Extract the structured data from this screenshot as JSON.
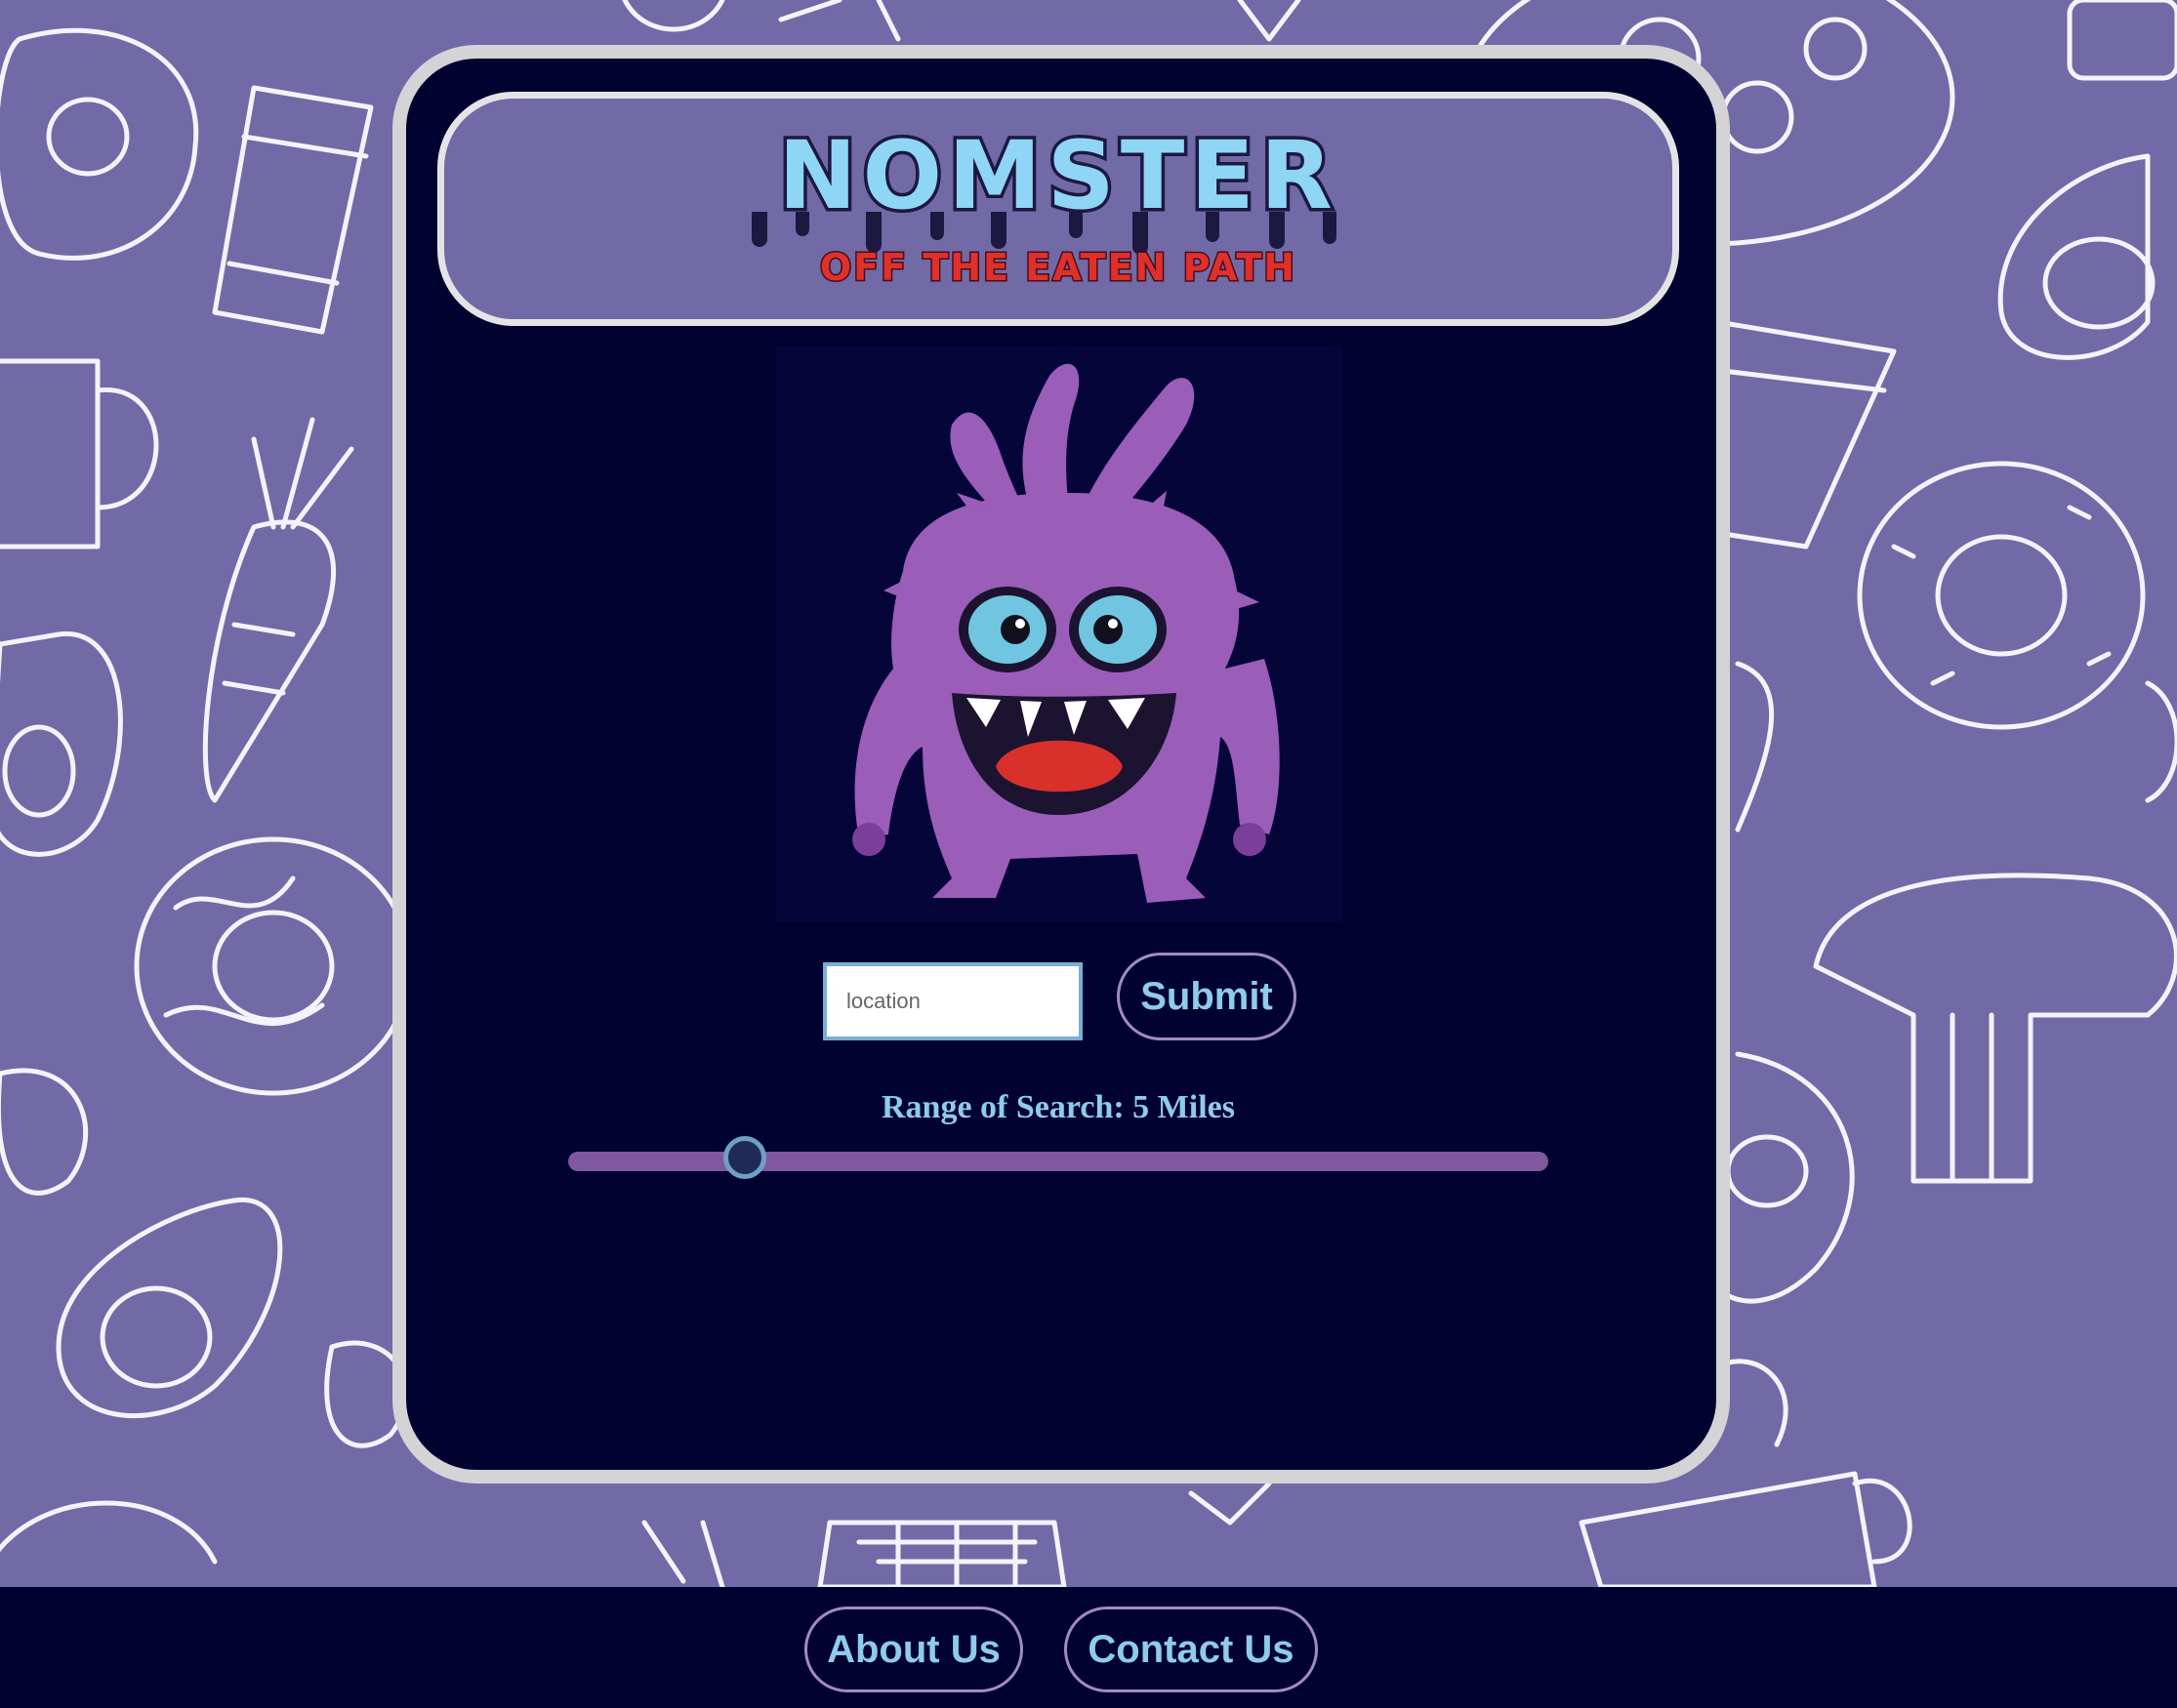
{
  "header": {
    "logo_title": "NOMSTER",
    "logo_tagline": "OFF THE EATEN PATH"
  },
  "search": {
    "placeholder": "location",
    "value": "",
    "submit_label": "Submit"
  },
  "range": {
    "label": "Range of Search: 5 Miles",
    "value_miles": 5,
    "fraction": 0.18
  },
  "footer": {
    "about_label": "About Us",
    "contact_label": "Contact Us"
  },
  "colors": {
    "page_background": "#716aa6",
    "card_background": "#020230",
    "accent_text": "#8ecbec",
    "tagline": "#e0302b",
    "slider_track": "#7f58a0",
    "monster": "#9a5db8"
  },
  "icons": {
    "logo": "nomster-logo",
    "mascot": "purple-monster-illustration"
  }
}
